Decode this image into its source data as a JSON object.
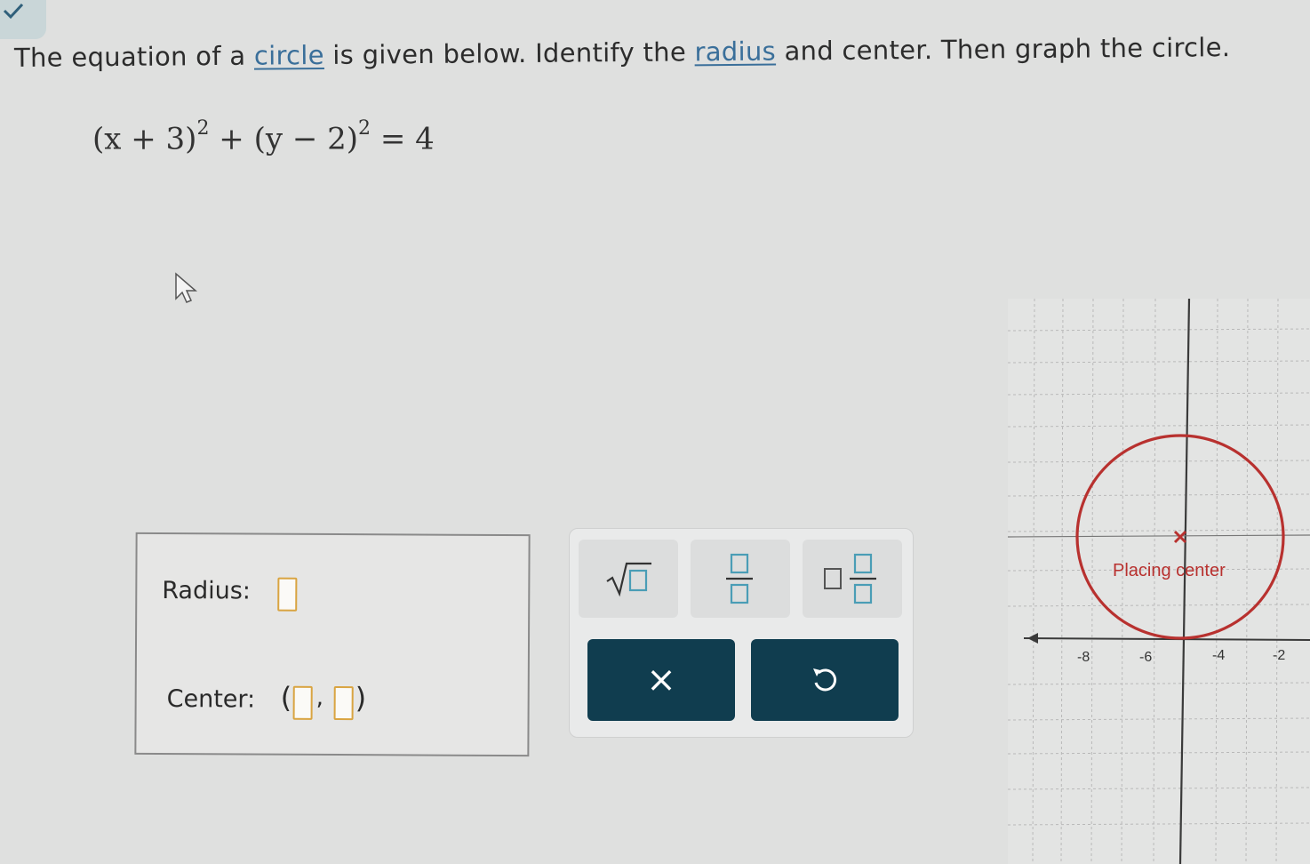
{
  "question": {
    "part1": "The equation of a ",
    "link1": "circle",
    "part2": " is given below. Identify the ",
    "link2": "radius",
    "part3": " and center. Then graph the circle."
  },
  "equation": {
    "lhs_a": "(x + 3)",
    "exp_a": "2",
    "plus": " + ",
    "lhs_b": "(y − 2)",
    "exp_b": "2",
    "rhs": " = 4"
  },
  "answer": {
    "radius_label": "Radius:",
    "radius_value": "",
    "center_label": "Center:",
    "center_open": "(",
    "center_sep": ",",
    "center_close": ")",
    "center_x_value": "",
    "center_y_value": ""
  },
  "keypad": {
    "keys": [
      "sqrt-template",
      "fraction-template",
      "mixed-number-template"
    ],
    "clear_symbol": "×",
    "undo_symbol": "undo-icon"
  },
  "graph": {
    "x_tick_labels": [
      "-8",
      "-6",
      "-4",
      "-2"
    ],
    "status_text": "Placing center",
    "circle_color": "#b8312f"
  }
}
